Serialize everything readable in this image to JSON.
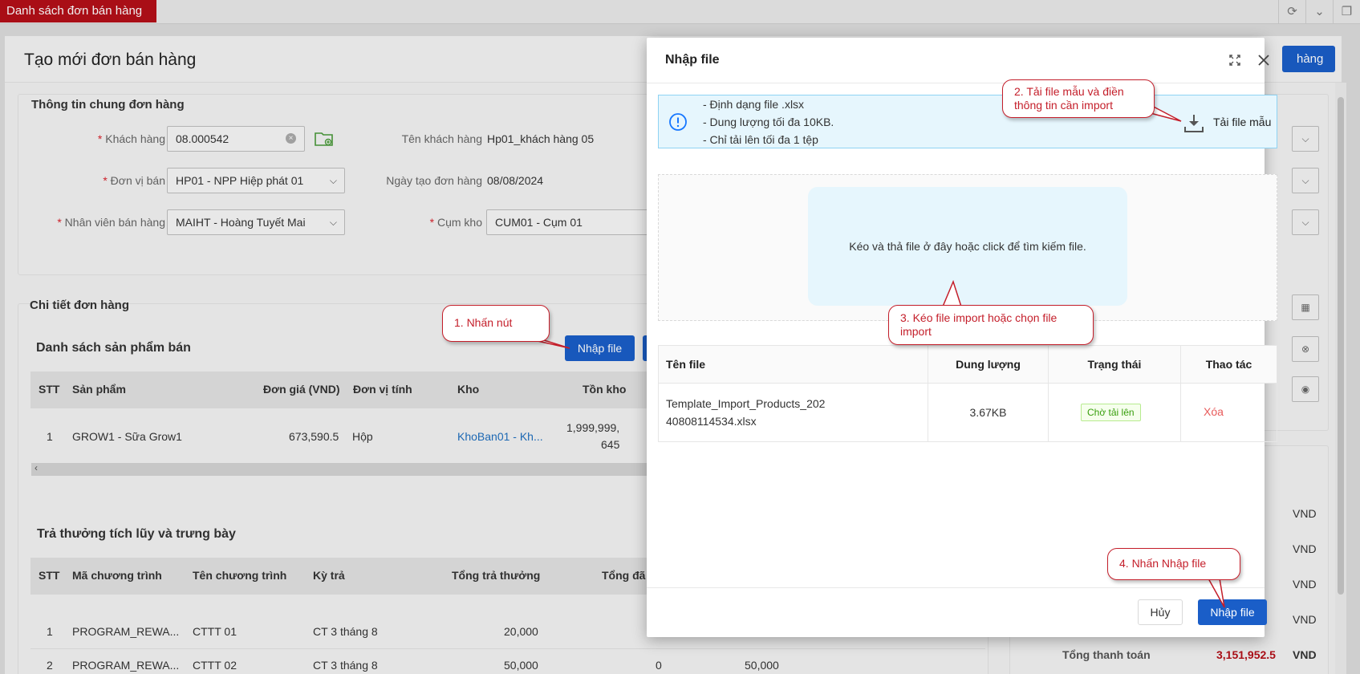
{
  "app": {
    "tab_title": "Danh sách đơn bán hàng",
    "page_title": "Tạo mới đơn bán hàng",
    "save_label": "hàng"
  },
  "general": {
    "section_title": "Thông tin chung đơn hàng",
    "customer_label": "Khách hàng",
    "customer_value": "08.000542",
    "customer_name_label": "Tên khách hàng",
    "customer_name_value": "Hp01_khách hàng 05",
    "unit_label": "Đơn vị bán",
    "unit_value": "HP01 - NPP Hiệp phát 01",
    "created_date_label": "Ngày tạo đơn hàng",
    "created_date_value": "08/08/2024",
    "staff_label": "Nhân viên bán hàng",
    "staff_value": "MAIHT - Hoàng Tuyết Mai",
    "warehouse_cluster_label": "Cụm kho",
    "warehouse_cluster_value": "CUM01 - Cụm 01"
  },
  "detail": {
    "section_title": "Chi tiết đơn hàng",
    "products_title": "Danh sách sản phẩm bán",
    "import_button": "Nhập file",
    "columns": [
      "STT",
      "Sản phẩm",
      "Đơn giá (VND)",
      "Đơn vị tính",
      "Kho",
      "Tồn kho"
    ],
    "row": {
      "stt": "1",
      "product": "GROW1 - Sữa Grow1",
      "price": "673,590.5",
      "unit": "Hộp",
      "warehouse": "KhoBan01 - Kh...",
      "stock_line1": "1,999,999,",
      "stock_line2": "645"
    }
  },
  "rewards": {
    "section_title": "Trả thưởng tích lũy và trưng bày",
    "columns": [
      "STT",
      "Mã chương trình",
      "Tên chương trình",
      "Kỳ trả",
      "Tổng trả thưởng",
      "Tổng đã"
    ],
    "rows": [
      {
        "stt": "1",
        "code": "PROGRAM_REWA...",
        "name": "CTTT 01",
        "period": "CT 3 tháng 8",
        "total": "20,000"
      },
      {
        "stt": "2",
        "code": "PROGRAM_REWA...",
        "name": "CTTT 02",
        "period": "CT 3 tháng 8",
        "total": "50,000",
        "paid": "0",
        "extra": "50,000"
      }
    ]
  },
  "summary": {
    "currency": "VND",
    "total_label": "Tổng thanh toán",
    "total_value": "3,151,952.5"
  },
  "modal": {
    "title": "Nhập file",
    "info_lines": [
      "- Định dạng file .xlsx",
      "- Dung lượng tối đa 10KB.",
      "- Chỉ tải lên tối đa 1 tệp"
    ],
    "download_template": "Tải file mẫu",
    "drop_text": "Kéo và thả file ở đây hoặc click để tìm kiếm file.",
    "table": {
      "columns": [
        "Tên file",
        "Dung lượng",
        "Trạng thái",
        "Thao tác"
      ],
      "row": {
        "file_name_line1": "Template_Import_Products_202",
        "file_name_line2": "40808114534.xlsx",
        "size": "3.67KB",
        "status": "Chờ tải lên",
        "action": "Xóa"
      }
    },
    "cancel_label": "Hủy",
    "import_label": "Nhập file"
  },
  "callouts": {
    "step1": "1. Nhấn nút",
    "step2": "2. Tải file mẫu và điền thông tin cần import",
    "step3": "3. Kéo file import hoặc chọn file import",
    "step4": "4. Nhấn Nhập file"
  },
  "colors": {
    "brand_red": "#b40f18",
    "primary_blue": "#1a5ec8",
    "callout_red": "#c41e2a",
    "info_bg": "#e6f6fd",
    "delete_red": "#e85a5a"
  }
}
